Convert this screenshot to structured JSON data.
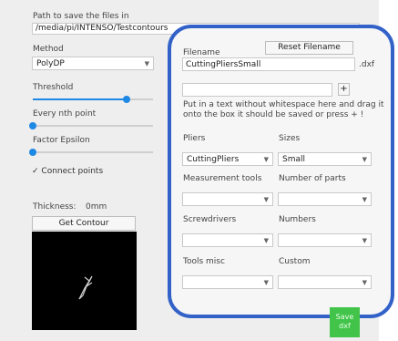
{
  "path": {
    "label": "Path to save the files in",
    "value": "/media/pi/INTENSO/Testcontours"
  },
  "method": {
    "label": "Method",
    "selected": "PolyDP"
  },
  "threshold": {
    "label": "Threshold",
    "level": 0.78
  },
  "every_nth": {
    "label": "Every nth point",
    "level": 0.0
  },
  "epsilon": {
    "label": "Factor Epsilon",
    "level": 0.0
  },
  "connect": {
    "label": "Connect points",
    "checked": true,
    "mark": "✓"
  },
  "thickness": {
    "label": "Thickness:",
    "value": "0mm"
  },
  "get_contour_label": "Get Contour",
  "filename": {
    "label": "Filename",
    "value": "CuttingPliersSmall",
    "ext": ".dxf",
    "reset_label": "Reset Filename"
  },
  "tag_input": {
    "value": "",
    "add_label": "+"
  },
  "instructions": {
    "line1": "Put in a text without whitespace here and drag it",
    "line2": "onto the box it should be saved or press + !"
  },
  "categories": [
    {
      "label": "Pliers",
      "selected": "CuttingPliers"
    },
    {
      "label": "Sizes",
      "selected": "Small"
    },
    {
      "label": "Measurement tools",
      "selected": ""
    },
    {
      "label": "Number of parts",
      "selected": ""
    },
    {
      "label": "Screwdrivers",
      "selected": ""
    },
    {
      "label": "Numbers",
      "selected": ""
    },
    {
      "label": "Tools misc",
      "selected": ""
    },
    {
      "label": "Custom",
      "selected": ""
    }
  ],
  "save": {
    "line1": "Save",
    "line2": "dxf"
  },
  "colors": {
    "accent": "#1e88e5",
    "outline": "#3262c8",
    "save": "#42c44a"
  }
}
